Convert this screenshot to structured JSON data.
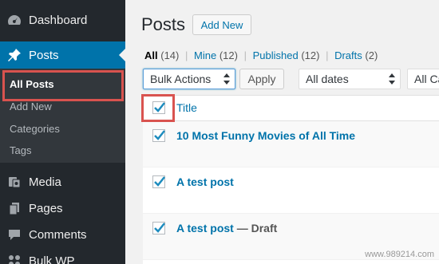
{
  "sidebar": {
    "items": [
      {
        "label": "Dashboard",
        "icon": "dashboard-icon"
      },
      {
        "label": "Posts",
        "icon": "pin-icon",
        "active": true
      },
      {
        "label": "Media",
        "icon": "media-icon"
      },
      {
        "label": "Pages",
        "icon": "pages-icon"
      },
      {
        "label": "Comments",
        "icon": "comments-icon"
      },
      {
        "label": "Bulk WP",
        "icon": "bulk-wp-icon"
      }
    ],
    "submenu": [
      "All Posts",
      "Add New",
      "Categories",
      "Tags"
    ],
    "highlight_color": "#d9534f",
    "active_color": "#0073aa"
  },
  "main": {
    "title": "Posts",
    "add_new": "Add New",
    "filters": {
      "all": "All",
      "all_count": "(14)",
      "mine": "Mine",
      "mine_count": "(12)",
      "published": "Published",
      "published_count": "(12)",
      "drafts": "Drafts",
      "drafts_count": "(2)",
      "sep": "|"
    },
    "bulk_actions": "Bulk Actions",
    "apply": "Apply",
    "dates": "All dates",
    "categories": "All Ca",
    "table": {
      "column_title": "Title",
      "rows": [
        {
          "title": "10 Most Funny Movies of All Time",
          "state": ""
        },
        {
          "title": "A test post",
          "state": ""
        },
        {
          "title": "A test post",
          "state": " — Draft"
        }
      ]
    }
  },
  "watermark": "www.989214.com"
}
